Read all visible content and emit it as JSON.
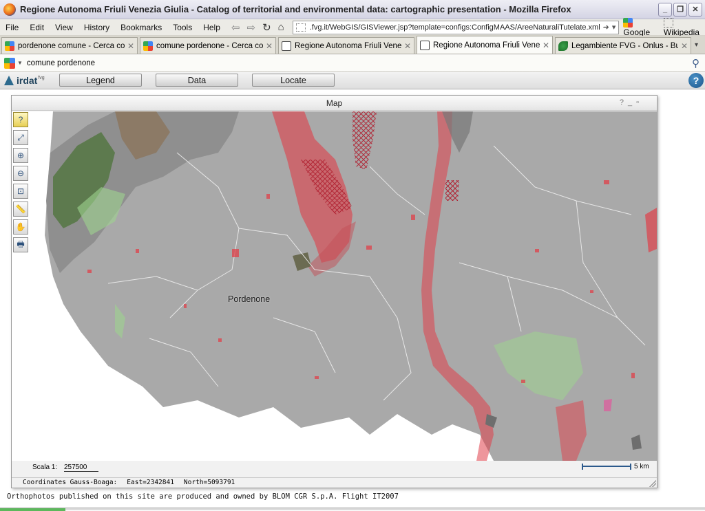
{
  "window": {
    "title": "Regione Autonoma Friuli Venezia Giulia - Catalog of territorial and environmental data: cartographic presentation - Mozilla Firefox"
  },
  "menu": [
    "File",
    "Edit",
    "View",
    "History",
    "Bookmarks",
    "Tools",
    "Help"
  ],
  "url": ".fvg.it/WebGIS/GISViewer.jsp?template=configs:ConfigMAAS/AreeNaturaliTutelate.xml",
  "bookmarks": [
    "Google",
    "Wikipedia"
  ],
  "tabs": [
    {
      "label": "pordenone comune - Cerca co...",
      "icon": "google-icon",
      "active": false
    },
    {
      "label": "comune pordenone - Cerca co...",
      "icon": "google-icon",
      "active": false
    },
    {
      "label": "Regione Autonoma Friuli Venez...",
      "icon": "region-icon",
      "active": false
    },
    {
      "label": "Regione Autonoma Friuli Venez...",
      "icon": "region-icon",
      "active": true
    },
    {
      "label": "Legambiente FVG - Onlus - Buli...",
      "icon": "leaf-icon",
      "active": false
    }
  ],
  "search": {
    "query": "comune pordenone"
  },
  "app": {
    "logo": "irdat",
    "logo_sup": "fvg",
    "buttons": [
      "Legend",
      "Data",
      "Locate"
    ],
    "help": "?"
  },
  "map": {
    "title": "Map",
    "controls": [
      "?",
      "_",
      "▫"
    ],
    "place_label": "Pordenone",
    "scale_label": "Scala 1:",
    "scale_value": "257500",
    "scalebar_text": "5 km",
    "coords_label": "Coordinates Gauss-Boaga:",
    "east": "East=2342841",
    "north": "North=5093791",
    "tools": [
      "query-icon",
      "zoom-extent-icon",
      "zoom-in-icon",
      "zoom-out-icon",
      "zoom-box-icon",
      "measure-icon",
      "pan-icon",
      "print-icon"
    ],
    "colors": {
      "base": "#a9a9a9",
      "protected": "#e0404a",
      "forest": "#5d7a4e",
      "wetland": "#9ed38f"
    }
  },
  "footer": "Orthophotos published on this site are produced and owned by BLOM CGR S.p.A. Flight IT2007"
}
